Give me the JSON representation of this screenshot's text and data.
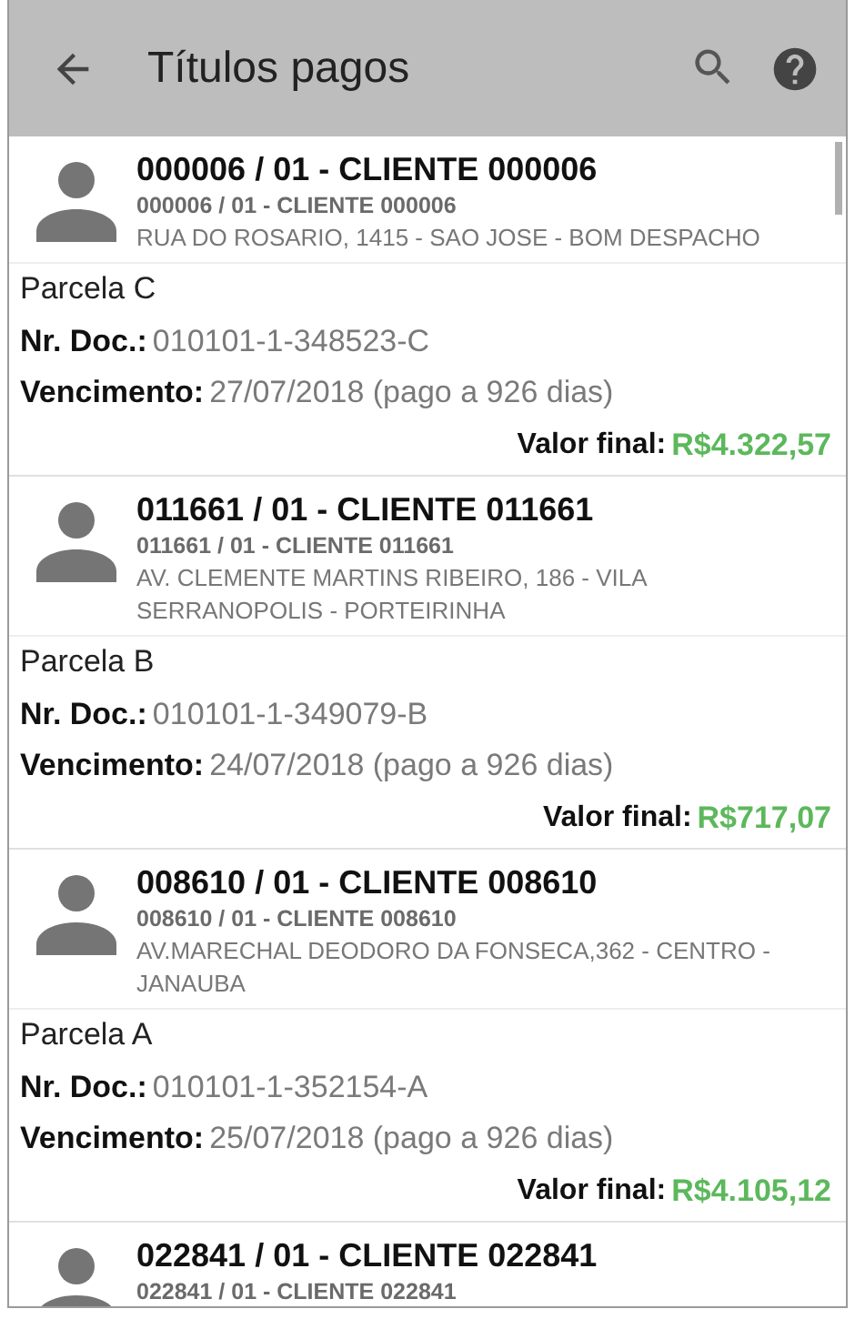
{
  "app_bar": {
    "title": "Títulos pagos"
  },
  "items": [
    {
      "title": "000006 / 01 - CLIENTE 000006",
      "subtitle": "000006 / 01 - CLIENTE 000006",
      "address": "RUA DO ROSARIO, 1415 - SAO JOSE - BOM DESPACHO",
      "installment": "Parcela C",
      "doc_label": "Nr. Doc.:",
      "doc_number": "010101-1-348523-C",
      "due_label": "Vencimento:",
      "due_value": "27/07/2018 (pago a 926 dias)",
      "total_label": "Valor final:",
      "total_value": "R$4.322,57"
    },
    {
      "title": "011661 / 01 - CLIENTE 011661",
      "subtitle": "011661 / 01 - CLIENTE 011661",
      "address": "AV. CLEMENTE MARTINS RIBEIRO, 186 - VILA SERRANOPOLIS - PORTEIRINHA",
      "installment": "Parcela B",
      "doc_label": "Nr. Doc.:",
      "doc_number": "010101-1-349079-B",
      "due_label": "Vencimento:",
      "due_value": "24/07/2018 (pago a 926 dias)",
      "total_label": "Valor final:",
      "total_value": "R$717,07"
    },
    {
      "title": "008610 / 01 - CLIENTE 008610",
      "subtitle": "008610 / 01 - CLIENTE 008610",
      "address": "AV.MARECHAL DEODORO DA FONSECA,362 - CENTRO - JANAUBA",
      "installment": "Parcela A",
      "doc_label": "Nr. Doc.:",
      "doc_number": "010101-1-352154-A",
      "due_label": "Vencimento:",
      "due_value": "25/07/2018 (pago a 926 dias)",
      "total_label": "Valor final:",
      "total_value": "R$4.105,12"
    },
    {
      "title": "022841 / 01 - CLIENTE 022841",
      "subtitle": "022841 / 01 - CLIENTE 022841"
    }
  ]
}
